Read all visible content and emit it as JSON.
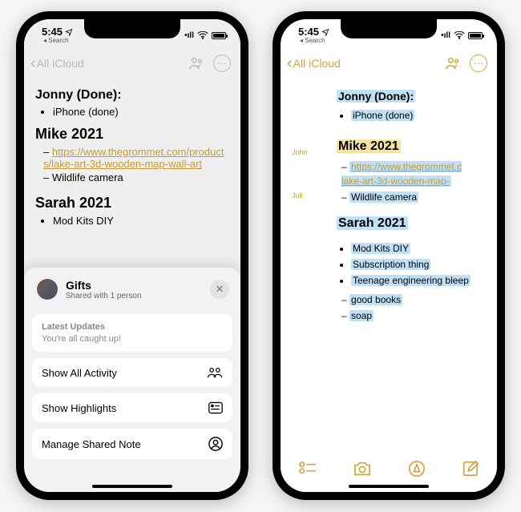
{
  "status": {
    "time": "5:45",
    "search": "Search"
  },
  "nav": {
    "back": "All iCloud"
  },
  "note": {
    "jonny": {
      "title": "Jonny (Done):",
      "items": [
        "iPhone (done)"
      ]
    },
    "mike": {
      "title": "Mike 2021",
      "link": "https://www.thegrommet.com/products/lake-art-3d-wooden-map-wall-art",
      "link_short": "https://www.thegrommet.c",
      "link_short2": "lake-art-3d-wooden-map-",
      "items": [
        "Wildlife camera"
      ]
    },
    "sarah": {
      "title": "Sarah 2021",
      "items_bul": [
        "Mod Kits DIY",
        "Subscription thing",
        "Teenage engineering bleep"
      ],
      "items_dash": [
        "good books",
        "soap"
      ],
      "partial": "Mod Kits DIY"
    }
  },
  "attrib": {
    "john": "John",
    "juli": "Juli"
  },
  "sheet": {
    "title": "Gifts",
    "sub": "Shared with 1 person",
    "latest_label": "Latest Updates",
    "latest_text": "You're all caught up!",
    "actions": {
      "all_activity": "Show All Activity",
      "highlights": "Show Highlights",
      "manage": "Manage Shared Note"
    }
  }
}
